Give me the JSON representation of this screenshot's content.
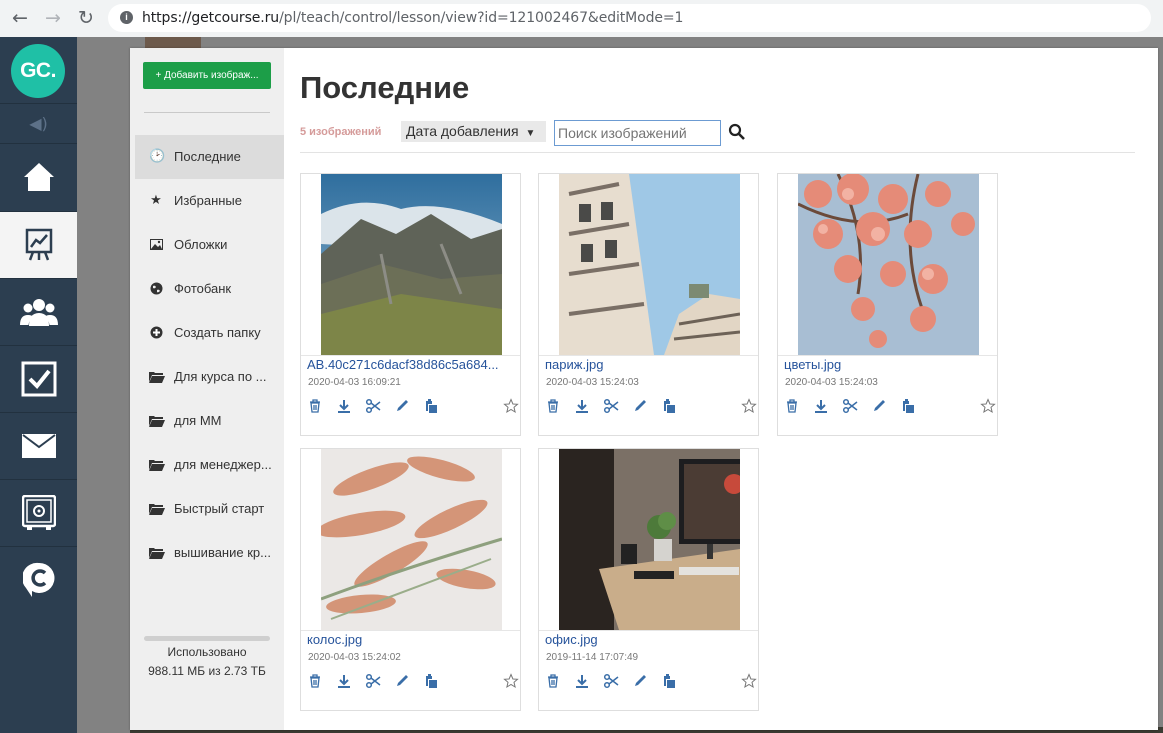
{
  "browser": {
    "url_host": "https://getcourse.ru",
    "url_path": "/pl/teach/control/lesson/view?id=121002467&editMode=1",
    "icons": [
      "back-icon",
      "forward-icon",
      "reload-icon",
      "site-info-icon"
    ]
  },
  "app_sidebar": {
    "logo": "GC.",
    "items": [
      {
        "name": "home",
        "icon": "home-icon"
      },
      {
        "name": "training",
        "icon": "chart-board-icon"
      },
      {
        "name": "users",
        "icon": "users-icon"
      },
      {
        "name": "tasks",
        "icon": "checkbox-icon"
      },
      {
        "name": "messages",
        "icon": "envelope-icon"
      },
      {
        "name": "safe",
        "icon": "safe-icon"
      },
      {
        "name": "chat",
        "icon": "chat-c-icon"
      }
    ],
    "active": "training"
  },
  "modal": {
    "add_button": "+ Добавить изображ...",
    "sidebar": [
      {
        "label": "Последние",
        "icon": "clock-icon"
      },
      {
        "label": "Избранные",
        "icon": "star-icon"
      },
      {
        "label": "Обложки",
        "icon": "image-icon"
      },
      {
        "label": "Фотобанк",
        "icon": "globe-icon"
      },
      {
        "label": "Создать папку",
        "icon": "plus-circle-icon"
      },
      {
        "label": "Для курса по ...",
        "icon": "folder-icon"
      },
      {
        "label": "для ММ",
        "icon": "folder-icon"
      },
      {
        "label": "для менеджер...",
        "icon": "folder-icon"
      },
      {
        "label": "Быстрый старт",
        "icon": "folder-icon"
      },
      {
        "label": "вышивание кр...",
        "icon": "folder-icon"
      }
    ],
    "usage_label": "Использовано",
    "usage_value": "988.11 МБ из 2.73 ТБ",
    "title": "Последние",
    "count": "5 изображений",
    "sort_label": "Дата добавления",
    "search_placeholder": "Поиск изображений",
    "images": [
      {
        "name": "AB.40c271c6dacf38d86c5a684...",
        "date": "2020-04-03 16:09:21",
        "photo": "mountain"
      },
      {
        "name": "париж.jpg",
        "date": "2020-04-03 15:24:03",
        "photo": "paris"
      },
      {
        "name": "цветы.jpg",
        "date": "2020-04-03 15:24:03",
        "photo": "flowers"
      },
      {
        "name": "колос.jpg",
        "date": "2020-04-03 15:24:02",
        "photo": "spikelets"
      },
      {
        "name": "офис.jpg",
        "date": "2019-11-14 17:07:49",
        "photo": "office"
      }
    ],
    "card_actions": [
      "trash-icon",
      "download-icon",
      "scissors-icon",
      "pencil-icon",
      "paste-icon",
      "star-outline-icon"
    ],
    "colors": {
      "accent": "#1c9e48",
      "link": "#26539b",
      "sidebar": "#2c3e50",
      "logo": "#1fc0a6"
    }
  }
}
